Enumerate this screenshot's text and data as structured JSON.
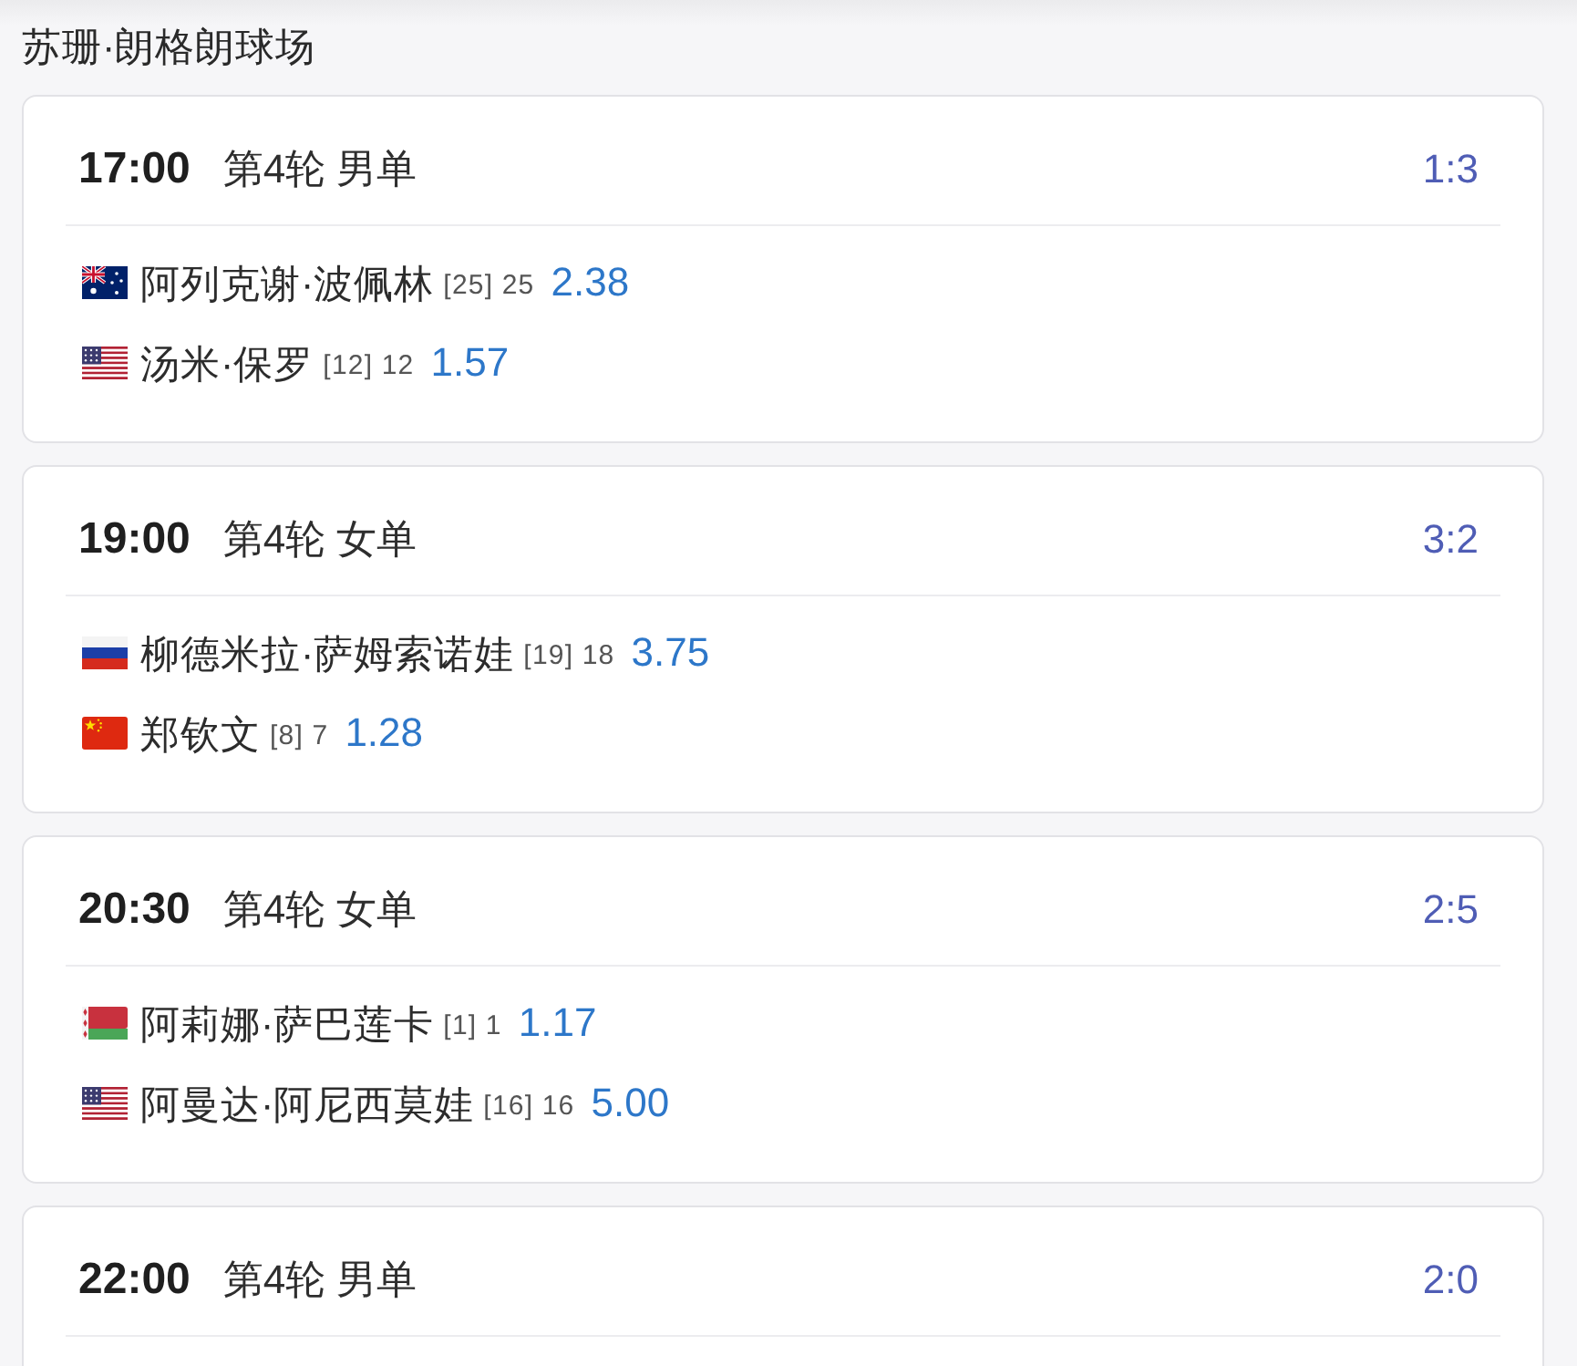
{
  "venue": {
    "title": "苏珊·朗格朗球场"
  },
  "matches": [
    {
      "time": "17:00",
      "round": "第4轮 男单",
      "score": "1:3",
      "players": [
        {
          "kind": "australia",
          "name": "阿列克谢·波佩林",
          "seed": "[25] 25",
          "odds": "2.38"
        },
        {
          "kind": "usa",
          "name": "汤米·保罗",
          "seed": "[12] 12",
          "odds": "1.57"
        }
      ]
    },
    {
      "time": "19:00",
      "round": "第4轮 女单",
      "score": "3:2",
      "players": [
        {
          "kind": "russia",
          "name": "柳德米拉·萨姆索诺娃",
          "seed": "[19] 18",
          "odds": "3.75"
        },
        {
          "kind": "china",
          "name": "郑钦文",
          "seed": "[8] 7",
          "odds": "1.28"
        }
      ]
    },
    {
      "time": "20:30",
      "round": "第4轮 女单",
      "score": "2:5",
      "players": [
        {
          "kind": "belarus",
          "name": "阿莉娜·萨巴莲卡",
          "seed": "[1] 1",
          "odds": "1.17"
        },
        {
          "kind": "usa",
          "name": "阿曼达·阿尼西莫娃",
          "seed": "[16] 16",
          "odds": "5.00"
        }
      ]
    },
    {
      "time": "22:00",
      "round": "第4轮 男单",
      "score": "2:0"
    }
  ]
}
